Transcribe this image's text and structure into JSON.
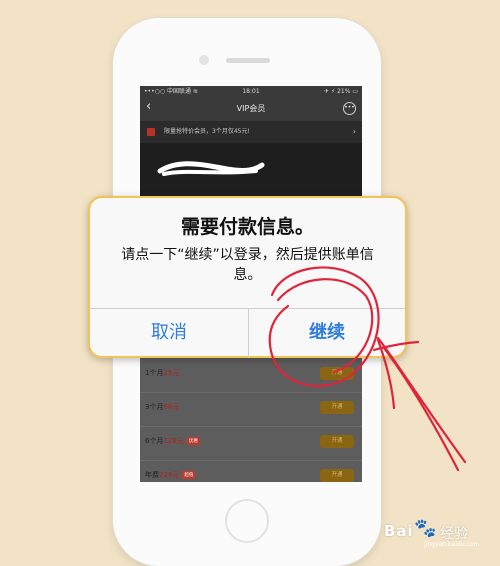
{
  "status_bar": {
    "carrier": "•••○○ 中国联通 ≋",
    "time": "18:01",
    "battery": "✈ ⚡ 21% ▭"
  },
  "nav": {
    "back": "‹",
    "title": "VIP会员",
    "more": "•••"
  },
  "promo": {
    "text": "限量抢特价会员，3个月仅45元!",
    "arrow": "›"
  },
  "price_list": [
    {
      "period": "1个月",
      "amount": "25元",
      "tag": "",
      "button": "开通"
    },
    {
      "period": "3个月",
      "amount": "68元",
      "tag": "",
      "button": "开通"
    },
    {
      "period": "6个月",
      "amount": "128元",
      "tag": "优惠",
      "button": "开通"
    },
    {
      "period": "年费",
      "amount": "228元",
      "tag": "超值",
      "button": "开通"
    }
  ],
  "alert": {
    "title": "需要付款信息。",
    "message": "请点一下“继续”以登录，然后提供账单信息。",
    "cancel": "取消",
    "continue": "继续"
  },
  "colors": {
    "background": "#f3e3c6",
    "alert_border": "#f2c454",
    "button_text": "#2f7de1",
    "annotation": "#e0243a"
  },
  "watermark": {
    "brand": "Bai",
    "sub": "经验",
    "url": "jingyan.baidu.com"
  }
}
